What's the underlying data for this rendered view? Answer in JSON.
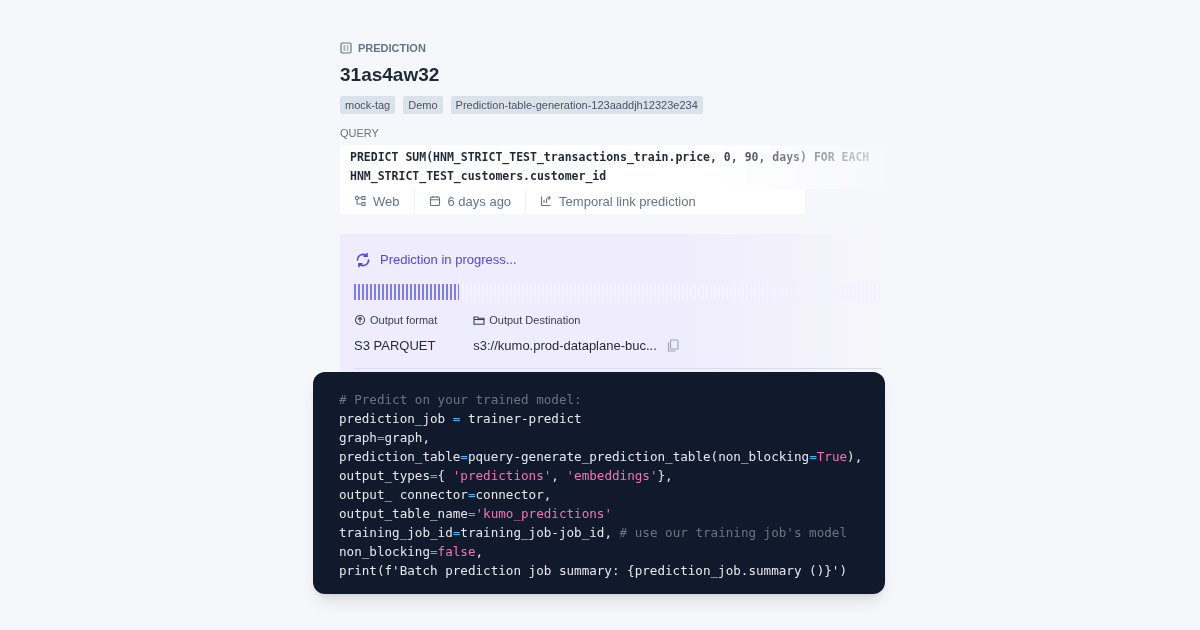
{
  "header": {
    "section_label": "PREDICTION",
    "title": "31as4aw32"
  },
  "tags": [
    "mock-tag",
    "Demo",
    "Prediction-table-generation-123aaddjh12323e234"
  ],
  "query": {
    "label": "QUERY",
    "lines": [
      "PREDICT SUM(HNM_STRICT_TEST_transactions_train.price, 0, 90, days) FOR EACH",
      "HNM_STRICT_TEST_customers.customer_id"
    ]
  },
  "meta": [
    {
      "kind": "source",
      "text": "Web"
    },
    {
      "kind": "date",
      "text": "6 days ago"
    },
    {
      "kind": "task",
      "text": "Temporal link prediction"
    }
  ],
  "progress": {
    "status": "Prediction in progress...",
    "level": 0.2
  },
  "outputs": [
    {
      "kind": "format",
      "label": "Output format",
      "value": "S3 PARQUET",
      "copyable": false
    },
    {
      "kind": "destination",
      "label": "Output Destination",
      "value": "s3://kumo.prod-dataplane-buc...",
      "copyable": true
    }
  ],
  "code": [
    [
      {
        "kind": "comment",
        "text": "# Predict on your trained model:"
      }
    ],
    [
      {
        "kind": "plain",
        "text": "prediction_job "
      },
      {
        "kind": "op",
        "text": "="
      },
      {
        "kind": "plain",
        "text": " trainer-predict"
      }
    ],
    [
      {
        "kind": "plain",
        "text": "graph"
      },
      {
        "kind": "op",
        "text": "="
      },
      {
        "kind": "plain",
        "text": "graph,"
      }
    ],
    [
      {
        "kind": "plain",
        "text": "prediction_table"
      },
      {
        "kind": "op",
        "text": "="
      },
      {
        "kind": "plain",
        "text": "pquery-generate_prediction_table(non_blocking"
      },
      {
        "kind": "op",
        "text": "="
      },
      {
        "kind": "keyword",
        "text": "True"
      },
      {
        "kind": "plain",
        "text": "),"
      }
    ],
    [
      {
        "kind": "plain",
        "text": "output_types"
      },
      {
        "kind": "op",
        "text": "="
      },
      {
        "kind": "plain",
        "text": "{ "
      },
      {
        "kind": "string",
        "text": "'predictions'"
      },
      {
        "kind": "plain",
        "text": ", "
      },
      {
        "kind": "string",
        "text": "'embeddings'"
      },
      {
        "kind": "plain",
        "text": "},"
      }
    ],
    [
      {
        "kind": "plain",
        "text": "output_ connector"
      },
      {
        "kind": "op",
        "text": "="
      },
      {
        "kind": "plain",
        "text": "connector,"
      }
    ],
    [
      {
        "kind": "plain",
        "text": "output_table_name"
      },
      {
        "kind": "op",
        "text": "="
      },
      {
        "kind": "string",
        "text": "'kumo_predictions'"
      }
    ],
    [
      {
        "kind": "plain",
        "text": "training_job_id"
      },
      {
        "kind": "op",
        "text": "="
      },
      {
        "kind": "plain",
        "text": "training_job-job_id, "
      },
      {
        "kind": "comment",
        "text": "# use our training job's model"
      }
    ],
    [
      {
        "kind": "plain",
        "text": "non_blocking"
      },
      {
        "kind": "op",
        "text": "="
      },
      {
        "kind": "keyword",
        "text": "false"
      },
      {
        "kind": "plain",
        "text": ","
      }
    ],
    [
      {
        "kind": "plain",
        "text": "print(f'Batch prediction job summary: {prediction_job.summary ()}')"
      }
    ]
  ]
}
